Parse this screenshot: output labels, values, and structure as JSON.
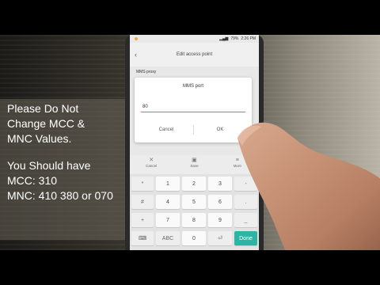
{
  "status_bar": {
    "time": "2:26 PM",
    "battery": "79%"
  },
  "app_bar": {
    "title": "Edit access point"
  },
  "settings": {
    "mms_proxy_label": "MMS proxy"
  },
  "dialog": {
    "title": "MMS port",
    "input_value": "80",
    "cancel_label": "Cancel",
    "ok_label": "OK"
  },
  "action_bar": {
    "items": [
      {
        "label": "Cancel",
        "icon": "close-icon"
      },
      {
        "label": "Save",
        "icon": "save-icon"
      },
      {
        "label": "More",
        "icon": "more-icon"
      }
    ]
  },
  "keyboard": {
    "rows": [
      [
        "*",
        "1",
        "2",
        "3",
        "-"
      ],
      [
        "#",
        "4",
        "5",
        "6",
        "."
      ],
      [
        "+",
        "7",
        "8",
        "9",
        "_"
      ],
      [
        "⌨",
        "ABC",
        "0",
        "⏎"
      ]
    ],
    "done_label": "Done"
  },
  "caption": {
    "lines": [
      "Please Do Not",
      "Change MCC &",
      "MNC Values.",
      "",
      "You Should have",
      "MCC: 310",
      "MNC: 410 380 or 070"
    ]
  }
}
